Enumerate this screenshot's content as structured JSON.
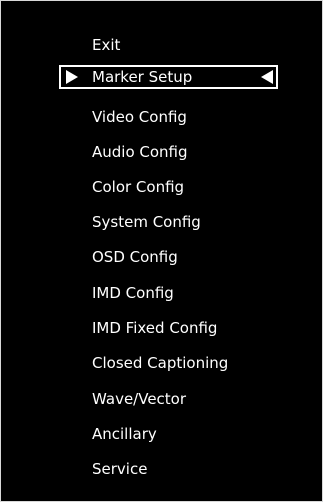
{
  "menu": {
    "items": [
      {
        "label": "Exit"
      },
      {
        "label": "Marker Setup",
        "selected": true
      },
      {
        "label": "Video Config"
      },
      {
        "label": "Audio Config"
      },
      {
        "label": "Color Config"
      },
      {
        "label": "System Config"
      },
      {
        "label": "OSD Config"
      },
      {
        "label": "IMD Config"
      },
      {
        "label": "IMD Fixed Config"
      },
      {
        "label": "Closed Captioning"
      },
      {
        "label": "Wave/Vector"
      },
      {
        "label": "Ancillary"
      },
      {
        "label": "Service"
      }
    ],
    "selection_indicator": {
      "left_icon": "triangle-right-icon",
      "right_icon": "triangle-left-icon"
    }
  },
  "colors": {
    "background": "#000000",
    "text": "#ffffff",
    "highlight_border": "#ffffff",
    "outer_border": "#d8d8d8"
  }
}
